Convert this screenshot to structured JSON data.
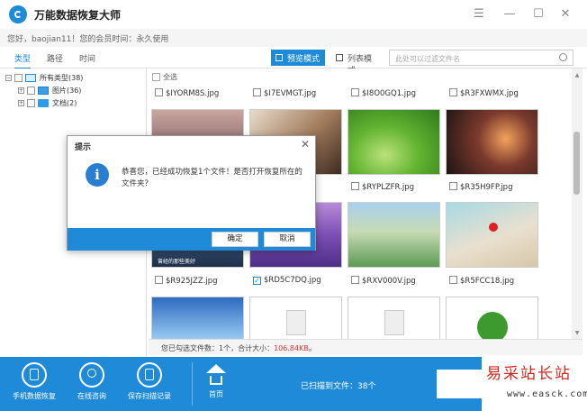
{
  "window": {
    "title": "万能数据恢复大师",
    "minimize": "—",
    "restore": "☐",
    "close": "✕",
    "menu": "☰"
  },
  "infobar": {
    "text": "您好，baojian11！您的会员时间：永久使用"
  },
  "tabs": [
    {
      "label": "类型"
    },
    {
      "label": "路径"
    },
    {
      "label": "时间"
    }
  ],
  "view_modes": {
    "preview": "预览模式",
    "list": "列表模式"
  },
  "filter": {
    "placeholder": "此处可以过滤文件名"
  },
  "tree": {
    "root": {
      "label": "所有类型(38)",
      "expander": "−"
    },
    "children": [
      {
        "label": "图片(36)",
        "expander": "+"
      },
      {
        "label": "文档(2)",
        "expander": "+"
      }
    ]
  },
  "grid": {
    "select_all": "全选",
    "row1_names": [
      "$IYORM8S.jpg",
      "$I7EVMGT.jpg",
      "$I8O0GQ1.jpg",
      "$R3FXWMX.jpg"
    ],
    "row2_names": [
      "$RYPLZFR.jpg",
      "$R35H9FP.jpg"
    ],
    "row3_names": [
      "$R925JZZ.jpg",
      "$RD5C7DQ.jpg",
      "$RXV000V.jpg",
      "$R5FCC18.jpg"
    ],
    "checked_mark": "✓",
    "thumb_caption": "曾经的那些美好"
  },
  "status": {
    "prefix": "您已勾选文件数：",
    "count": "1个",
    "mid": "，合计大小：",
    "size": "106.84KB",
    "suffix": "。"
  },
  "bottombar": {
    "items": [
      "手机数据恢复",
      "在线咨询",
      "保存扫描记录",
      "首页"
    ],
    "scan_text": "已扫描到文件：38个"
  },
  "dialog": {
    "title": "提示",
    "close": "✕",
    "icon": "i",
    "message": "恭喜您，已经成功恢复1个文件！是否打开恢复所在的文件夹？",
    "ok": "确定",
    "cancel": "取消"
  },
  "watermark": {
    "main": "易采站长站",
    "sub": "www.easck.com"
  }
}
